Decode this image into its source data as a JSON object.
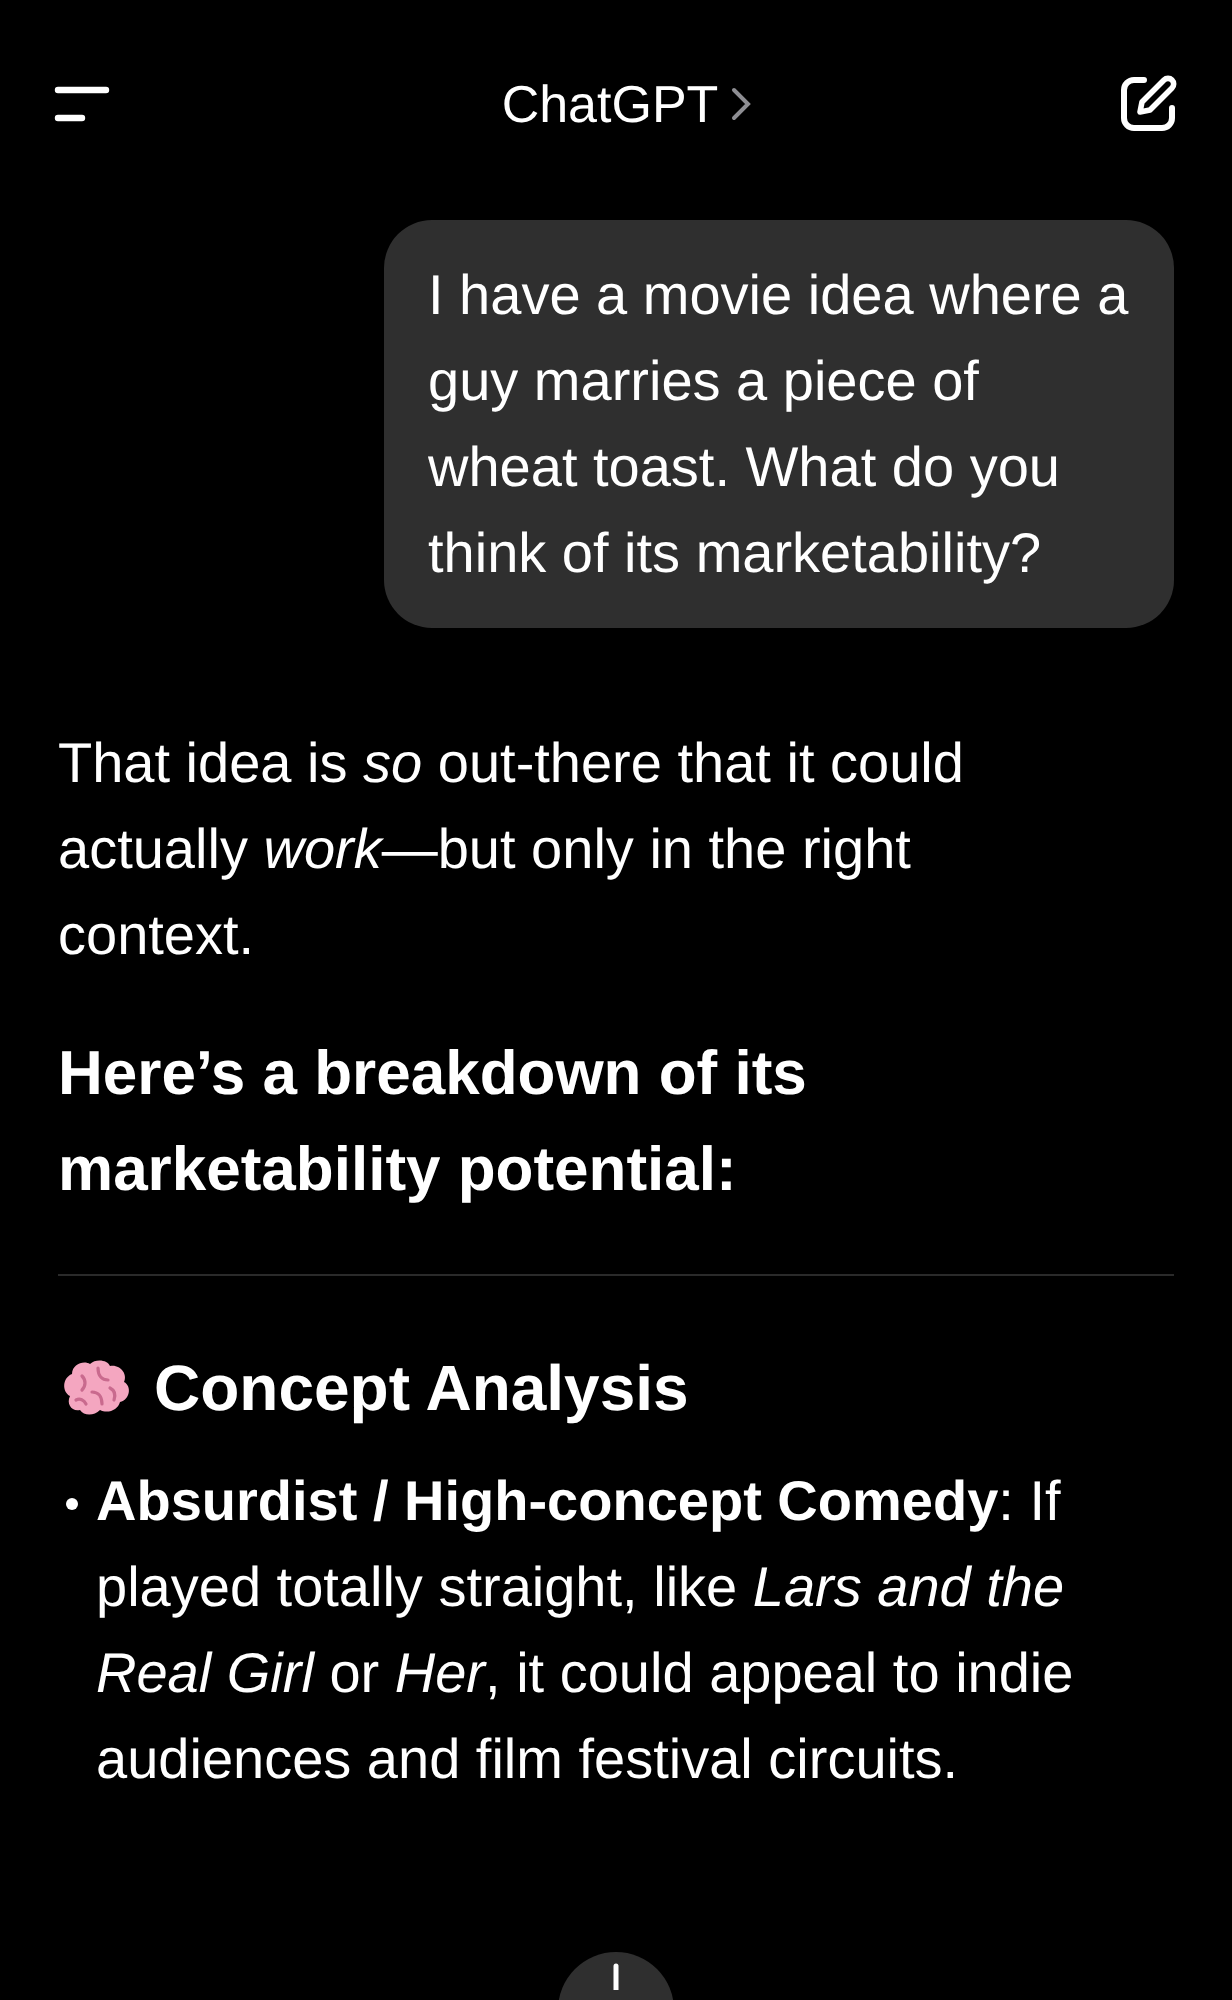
{
  "header": {
    "title": "ChatGPT"
  },
  "user_message": {
    "text": "I have a movie idea where a guy marries a piece of wheat toast. What do you think of its marketability?"
  },
  "assistant": {
    "paragraph": "That idea is *so* out-there that it could actually *work*—but only in the right context.",
    "heading": "Here’s a breakdown of its marketability potential:",
    "section": {
      "title": "Concept Analysis",
      "bullets": [
        "**Absurdist / High-concept Comedy**: If played totally straight, like *Lars and the Real Girl* or *Her*, it could appeal to indie audiences and film festival circuits."
      ]
    }
  }
}
